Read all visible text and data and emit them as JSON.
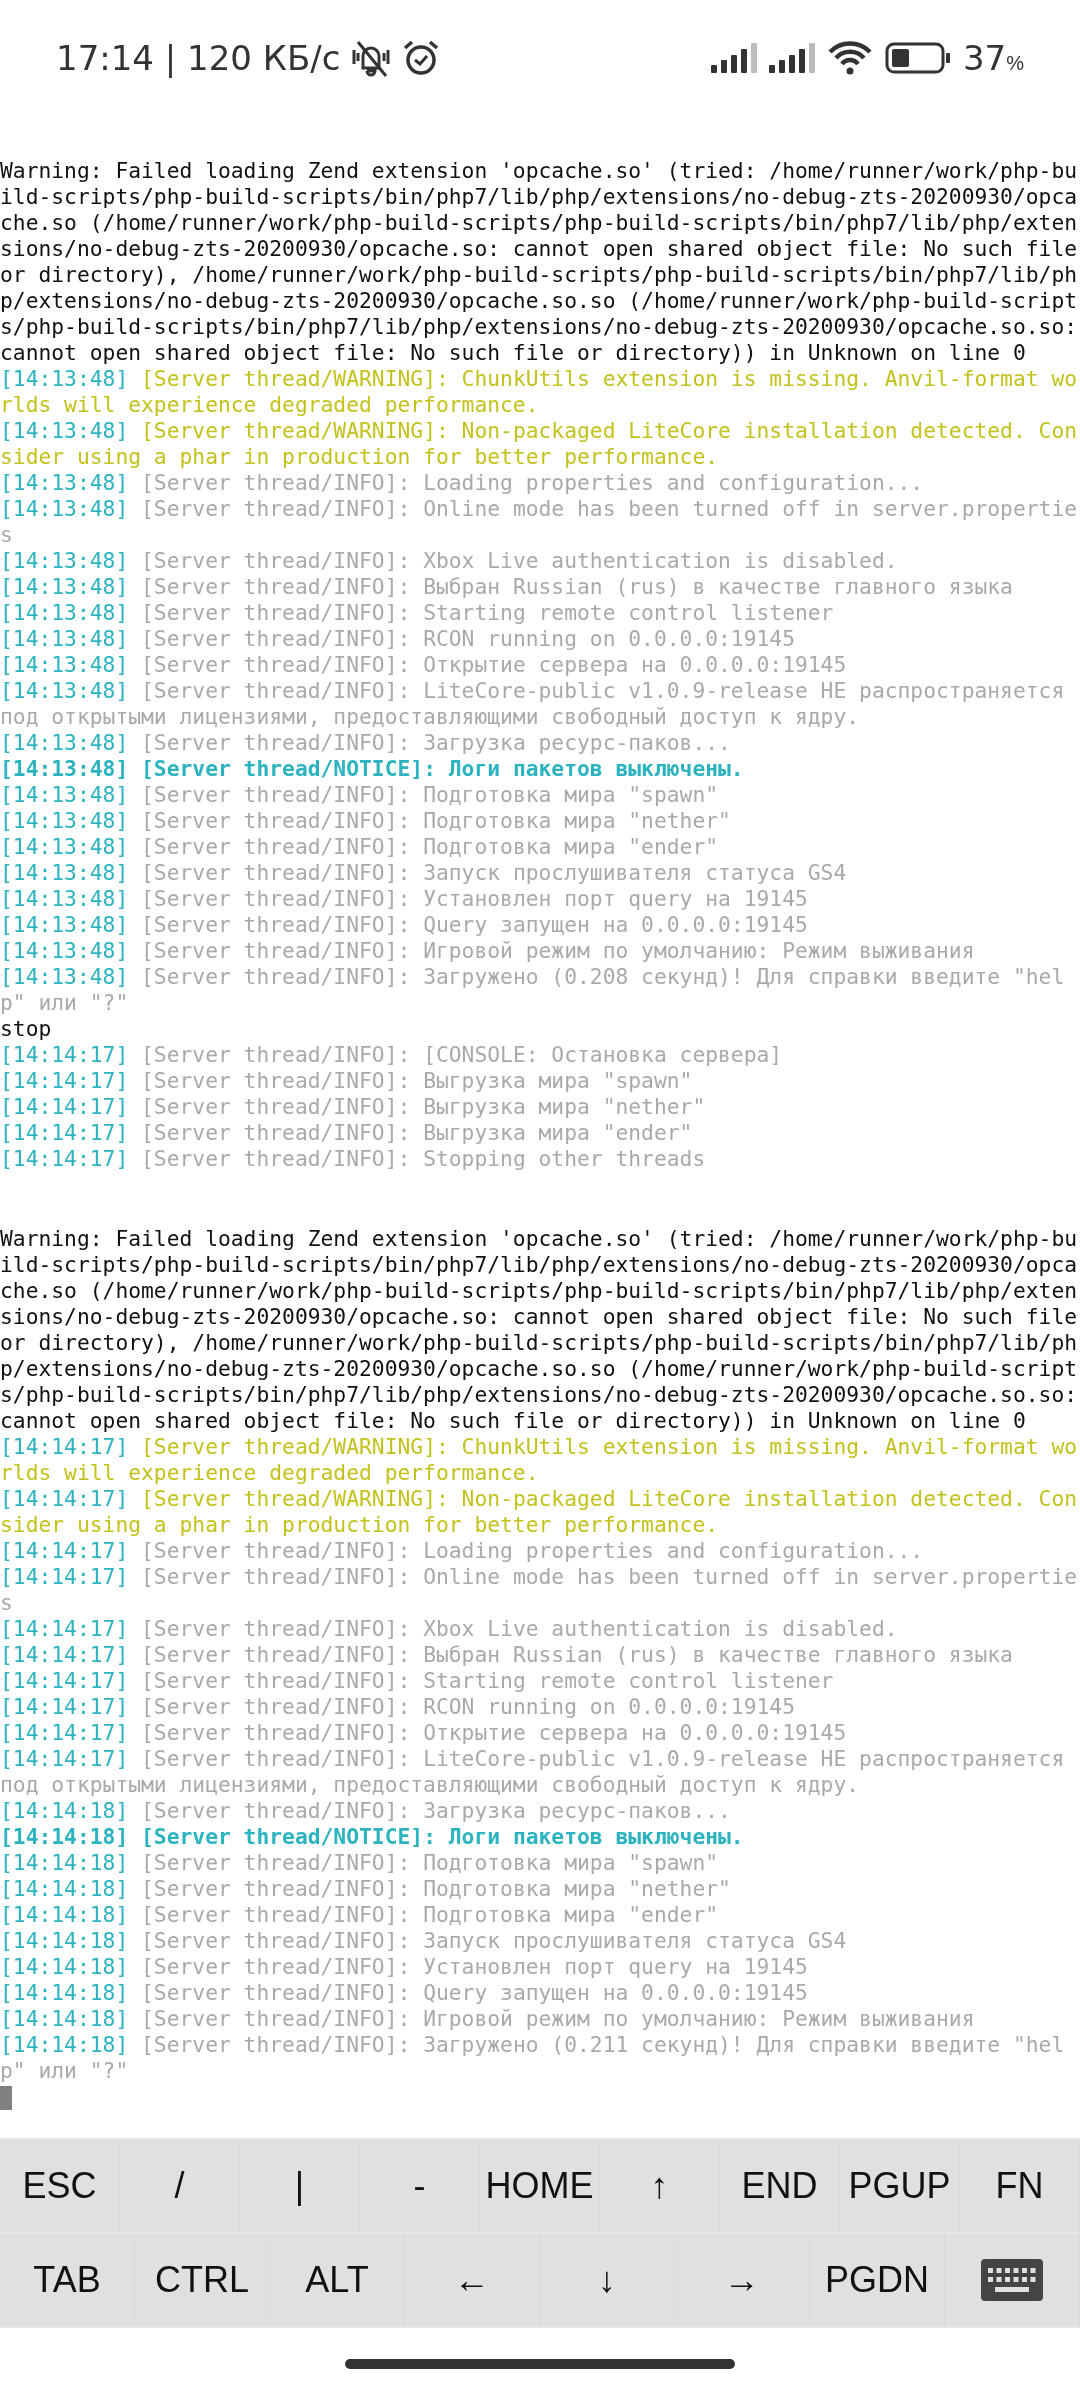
{
  "status_bar": {
    "time": "17:14 | 120 КБ/с",
    "battery": "37",
    "battery_unit": "%"
  },
  "sessions": [
    {
      "lines": [
        {
          "kind": "plain",
          "text": "Warning: Failed loading Zend extension 'opcache.so' (tried: /home/runner/work/php-build-scripts/php-build-scripts/bin/php7/lib/php/extensions/no-debug-zts-20200930/opcache.so (/home/runner/work/php-build-scripts/php-build-scripts/bin/php7/lib/php/extensions/no-debug-zts-20200930/opcache.so: cannot open shared object file: No such file or directory), /home/runner/work/php-build-scripts/php-build-scripts/bin/php7/lib/php/extensions/no-debug-zts-20200930/opcache.so.so (/home/runner/work/php-build-scripts/php-build-scripts/bin/php7/lib/php/extensions/no-debug-zts-20200930/opcache.so.so: cannot open shared object file: No such file or directory)) in Unknown on line 0"
        },
        {
          "kind": "warning",
          "time": "[14:13:48]",
          "text": "[Server thread/WARNING]: ChunkUtils extension is missing. Anvil-format worlds will experience degraded performance."
        },
        {
          "kind": "warning",
          "time": "[14:13:48]",
          "text": "[Server thread/WARNING]: Non-packaged LiteCore installation detected. Consider using a phar in production for better performance."
        },
        {
          "kind": "info",
          "time": "[14:13:48]",
          "text": "[Server thread/INFO]: Loading properties and configuration..."
        },
        {
          "kind": "info",
          "time": "[14:13:48]",
          "text": "[Server thread/INFO]: Online mode has been turned off in server.properties"
        },
        {
          "kind": "info",
          "time": "[14:13:48]",
          "text": "[Server thread/INFO]: Xbox Live authentication is disabled."
        },
        {
          "kind": "info",
          "time": "[14:13:48]",
          "text": "[Server thread/INFO]: Выбран Russian (rus) в качестве главного языка"
        },
        {
          "kind": "info",
          "time": "[14:13:48]",
          "text": "[Server thread/INFO]: Starting remote control listener"
        },
        {
          "kind": "info",
          "time": "[14:13:48]",
          "text": "[Server thread/INFO]: RCON running on 0.0.0.0:19145"
        },
        {
          "kind": "info",
          "time": "[14:13:48]",
          "text": "[Server thread/INFO]: Открытие сервера на 0.0.0.0:19145"
        },
        {
          "kind": "info",
          "time": "[14:13:48]",
          "text": "[Server thread/INFO]: LiteCore-public v1.0.9-release HE распространяется под открытыми лицензиями, предоставляющими свободный доступ к ядру."
        },
        {
          "kind": "info",
          "time": "[14:13:48]",
          "text": "[Server thread/INFO]: Загрузка ресурс-паков..."
        },
        {
          "kind": "notice",
          "time": "[14:13:48]",
          "text": "[Server thread/NOTICE]: Логи пакетов выключены."
        },
        {
          "kind": "info",
          "time": "[14:13:48]",
          "text": "[Server thread/INFO]: Подготовка мира \"spawn\""
        },
        {
          "kind": "info",
          "time": "[14:13:48]",
          "text": "[Server thread/INFO]: Подготовка мира \"nether\""
        },
        {
          "kind": "info",
          "time": "[14:13:48]",
          "text": "[Server thread/INFO]: Подготовка мира \"ender\""
        },
        {
          "kind": "info",
          "time": "[14:13:48]",
          "text": "[Server thread/INFO]: Запуск прослушивателя статуса GS4"
        },
        {
          "kind": "info",
          "time": "[14:13:48]",
          "text": "[Server thread/INFO]: Установлен порт query на 19145"
        },
        {
          "kind": "info",
          "time": "[14:13:48]",
          "text": "[Server thread/INFO]: Query запущен на 0.0.0.0:19145"
        },
        {
          "kind": "info",
          "time": "[14:13:48]",
          "text": "[Server thread/INFO]: Игровой режим по умолчанию: Режим выживания"
        },
        {
          "kind": "info",
          "time": "[14:13:48]",
          "text": "[Server thread/INFO]: Загружено (0.208 секунд)! Для справки введите \"help\" или \"?\""
        },
        {
          "kind": "plain",
          "text": "stop"
        },
        {
          "kind": "info",
          "time": "[14:14:17]",
          "text": "[Server thread/INFO]: [CONSOLE: Остановка сервера]"
        },
        {
          "kind": "info",
          "time": "[14:14:17]",
          "text": "[Server thread/INFO]: Выгрузка мира \"spawn\""
        },
        {
          "kind": "info",
          "time": "[14:14:17]",
          "text": "[Server thread/INFO]: Выгрузка мира \"nether\""
        },
        {
          "kind": "info",
          "time": "[14:14:17]",
          "text": "[Server thread/INFO]: Выгрузка мира \"ender\""
        },
        {
          "kind": "info",
          "time": "[14:14:17]",
          "text": "[Server thread/INFO]: Stopping other threads"
        }
      ]
    },
    {
      "lines": [
        {
          "kind": "plain",
          "text": "Warning: Failed loading Zend extension 'opcache.so' (tried: /home/runner/work/php-build-scripts/php-build-scripts/bin/php7/lib/php/extensions/no-debug-zts-20200930/opcache.so (/home/runner/work/php-build-scripts/php-build-scripts/bin/php7/lib/php/extensions/no-debug-zts-20200930/opcache.so: cannot open shared object file: No such file or directory), /home/runner/work/php-build-scripts/php-build-scripts/bin/php7/lib/php/extensions/no-debug-zts-20200930/opcache.so.so (/home/runner/work/php-build-scripts/php-build-scripts/bin/php7/lib/php/extensions/no-debug-zts-20200930/opcache.so.so: cannot open shared object file: No such file or directory)) in Unknown on line 0"
        },
        {
          "kind": "warning",
          "time": "[14:14:17]",
          "text": "[Server thread/WARNING]: ChunkUtils extension is missing. Anvil-format worlds will experience degraded performance."
        },
        {
          "kind": "warning",
          "time": "[14:14:17]",
          "text": "[Server thread/WARNING]: Non-packaged LiteCore installation detected. Consider using a phar in production for better performance."
        },
        {
          "kind": "info",
          "time": "[14:14:17]",
          "text": "[Server thread/INFO]: Loading properties and configuration..."
        },
        {
          "kind": "info",
          "time": "[14:14:17]",
          "text": "[Server thread/INFO]: Online mode has been turned off in server.properties"
        },
        {
          "kind": "info",
          "time": "[14:14:17]",
          "text": "[Server thread/INFO]: Xbox Live authentication is disabled."
        },
        {
          "kind": "info",
          "time": "[14:14:17]",
          "text": "[Server thread/INFO]: Выбран Russian (rus) в качестве главного языка"
        },
        {
          "kind": "info",
          "time": "[14:14:17]",
          "text": "[Server thread/INFO]: Starting remote control listener"
        },
        {
          "kind": "info",
          "time": "[14:14:17]",
          "text": "[Server thread/INFO]: RCON running on 0.0.0.0:19145"
        },
        {
          "kind": "info",
          "time": "[14:14:17]",
          "text": "[Server thread/INFO]: Открытие сервера на 0.0.0.0:19145"
        },
        {
          "kind": "info",
          "time": "[14:14:17]",
          "text": "[Server thread/INFO]: LiteCore-public v1.0.9-release HE распространяется под открытыми лицензиями, предоставляющими свободный доступ к ядру."
        },
        {
          "kind": "info",
          "time": "[14:14:18]",
          "text": "[Server thread/INFO]: Загрузка ресурс-паков..."
        },
        {
          "kind": "notice",
          "time": "[14:14:18]",
          "text": "[Server thread/NOTICE]: Логи пакетов выключены."
        },
        {
          "kind": "info",
          "time": "[14:14:18]",
          "text": "[Server thread/INFO]: Подготовка мира \"spawn\""
        },
        {
          "kind": "info",
          "time": "[14:14:18]",
          "text": "[Server thread/INFO]: Подготовка мира \"nether\""
        },
        {
          "kind": "info",
          "time": "[14:14:18]",
          "text": "[Server thread/INFO]: Подготовка мира \"ender\""
        },
        {
          "kind": "info",
          "time": "[14:14:18]",
          "text": "[Server thread/INFO]: Запуск прослушивателя статуса GS4"
        },
        {
          "kind": "info",
          "time": "[14:14:18]",
          "text": "[Server thread/INFO]: Установлен порт query на 19145"
        },
        {
          "kind": "info",
          "time": "[14:14:18]",
          "text": "[Server thread/INFO]: Query запущен на 0.0.0.0:19145"
        },
        {
          "kind": "info",
          "time": "[14:14:18]",
          "text": "[Server thread/INFO]: Игровой режим по умолчанию: Режим выживания"
        },
        {
          "kind": "info",
          "time": "[14:14:18]",
          "text": "[Server thread/INFO]: Загружено (0.211 секунд)! Для справки введите \"help\" или \"?\""
        }
      ]
    }
  ],
  "keys": [
    [
      {
        "kind": "text",
        "label": "ESC"
      },
      {
        "kind": "text",
        "label": "/"
      },
      {
        "kind": "text",
        "label": "|"
      },
      {
        "kind": "text",
        "label": "-"
      },
      {
        "kind": "text",
        "label": "HOME"
      },
      {
        "kind": "text",
        "label": "↑"
      },
      {
        "kind": "text",
        "label": "END"
      },
      {
        "kind": "text",
        "label": "PGUP"
      },
      {
        "kind": "text",
        "label": "FN"
      }
    ],
    [
      {
        "kind": "text",
        "label": "TAB"
      },
      {
        "kind": "text",
        "label": "CTRL"
      },
      {
        "kind": "text",
        "label": "ALT"
      },
      {
        "kind": "text",
        "label": "←"
      },
      {
        "kind": "text",
        "label": "↓"
      },
      {
        "kind": "text",
        "label": "→"
      },
      {
        "kind": "text",
        "label": "PGDN"
      },
      {
        "kind": "keyboard"
      }
    ]
  ]
}
